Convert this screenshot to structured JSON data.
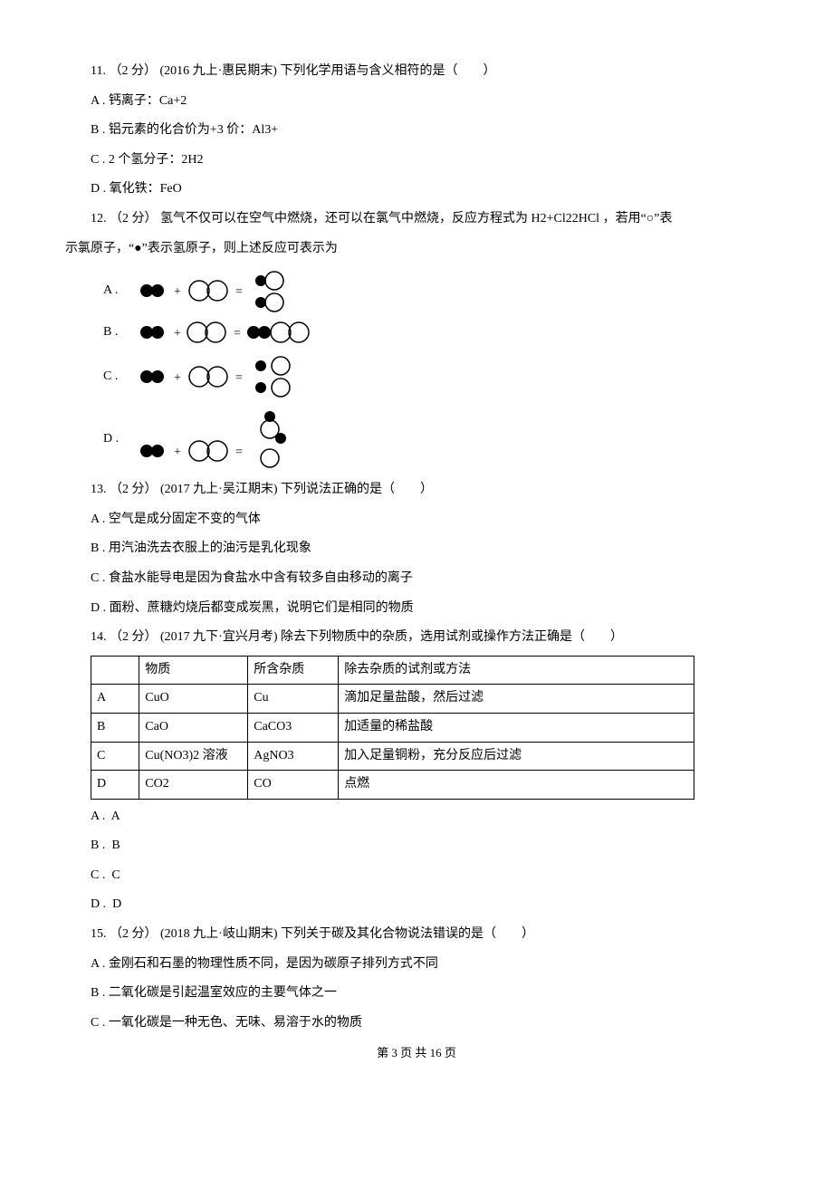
{
  "q11": {
    "stem": "11. （2 分） (2016 九上·惠民期末)  下列化学用语与含义相符的是（　　）",
    "A": "A .  钙离子：Ca+2",
    "B": "B .  铝元素的化合价为+3 价：Al3+",
    "C": "C .  2 个氢分子：2H2",
    "D": "D .  氧化铁：FeO"
  },
  "q12": {
    "stem_l1": "12. （2 分）  氢气不仅可以在空气中燃烧，还可以在氯气中燃烧，反应方程式为 H2+Cl22HCl ，若用“○”表",
    "stem_l2": "示氯原子，“●”表示氢原子，则上述反应可表示为",
    "A": "A .",
    "B": "B .",
    "C": "C .",
    "D": "D ."
  },
  "q13": {
    "stem": "13. （2 分） (2017 九上·吴江期末)  下列说法正确的是（　　）",
    "A": "A .  空气是成分固定不变的气体",
    "B": "B .  用汽油洗去衣服上的油污是乳化现象",
    "C": "C .  食盐水能导电是因为食盐水中含有较多自由移动的离子",
    "D": "D .  面粉、蔗糖灼烧后都变成炭黑，说明它们是相同的物质"
  },
  "q14": {
    "stem": "14. （2 分） (2017 九下·宜兴月考)  除去下列物质中的杂质，选用试剂或操作方法正确是（　　）",
    "head": [
      "",
      "物质",
      "所含杂质",
      "除去杂质的试剂或方法"
    ],
    "rows": [
      [
        "A",
        "CuO",
        "Cu",
        "滴加足量盐酸，然后过滤"
      ],
      [
        "B",
        "CaO",
        "CaCO3",
        "加适量的稀盐酸"
      ],
      [
        "C",
        "Cu(NO3)2 溶液",
        "AgNO3",
        "加入足量铜粉，充分反应后过滤"
      ],
      [
        "D",
        "CO2",
        "CO",
        "点燃"
      ]
    ],
    "A": "A .  A",
    "B": "B .  B",
    "C": "C .  C",
    "D": "D .  D"
  },
  "q15": {
    "stem": "15. （2 分） (2018 九上·岐山期末)  下列关于碳及其化合物说法错误的是（　　）",
    "A": "A .  金刚石和石墨的物理性质不同，是因为碳原子排列方式不同",
    "B": "B .  二氧化碳是引起温室效应的主要气体之一",
    "C": "C .  一氧化碳是一种无色、无味、易溶于水的物质"
  },
  "footer": "第 3 页 共 16 页"
}
